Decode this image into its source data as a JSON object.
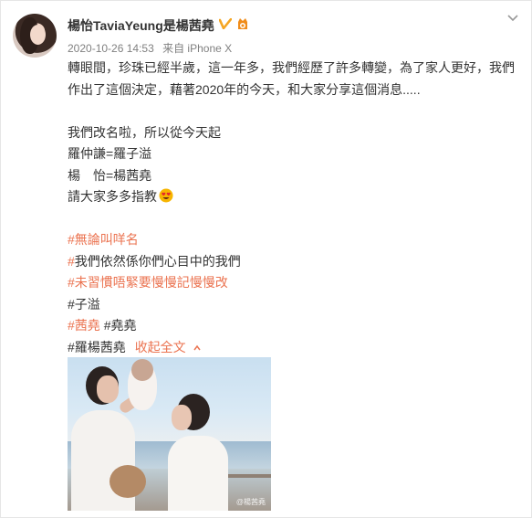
{
  "header": {
    "user_name": "楊怡TaviaYeung是楊茜堯",
    "timestamp": "2020-10-26 14:53",
    "source": "来自 iPhone X",
    "verified_icon": "verified-v-icon",
    "badge_icon": "fan-badge-icon",
    "menu_icon": "chevron-down-icon"
  },
  "post": {
    "line1": "轉眼間，珍珠已經半歲，這一年多，我們經歷了許多轉變，為了家人更好，我們",
    "line2": "作出了這個決定，藉著2020年的今天，和大家分享這個消息.....",
    "line3": "我們改名啦，所以從今天起",
    "line4": "羅仲謙=羅子溢",
    "line5": "楊　怡=楊茜堯",
    "line6": "請大家多多指教",
    "emoji": "heart-eyes-emoji",
    "topics": [
      "#無論叫咩名",
      "#我們依然係你們心目中的我們",
      "#未習慣唔緊要慢慢記慢慢改",
      "#子溢",
      "#茜堯",
      "#堯堯",
      "#羅楊茜堯"
    ],
    "collapse_label": "收起全文"
  },
  "photo": {
    "description_icon": "family-photo",
    "watermark": "@楊茜堯"
  },
  "colors": {
    "topic": "#eb7350",
    "text": "#333333",
    "meta": "#808080",
    "verified": "#f5a623"
  }
}
